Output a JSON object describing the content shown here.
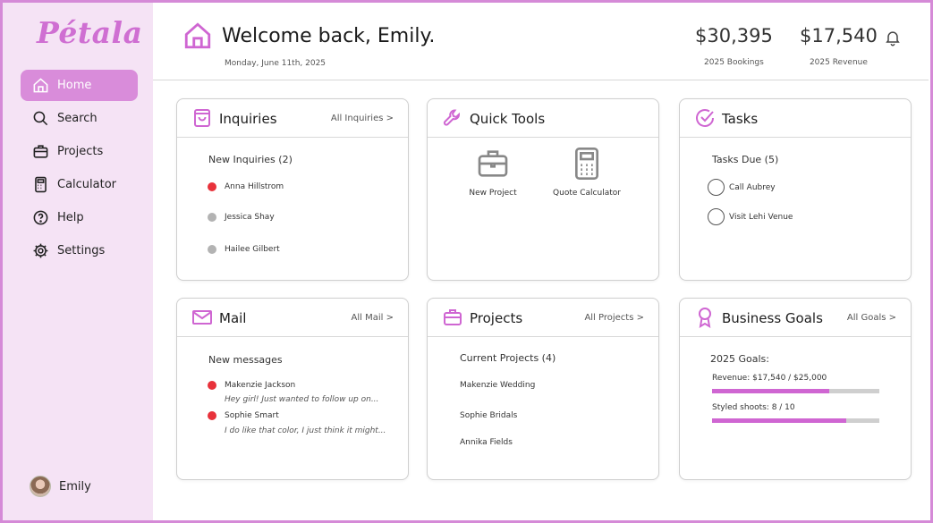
{
  "app": {
    "logo": "Pétala"
  },
  "colors": {
    "accent": "#cf66d2",
    "sidebar_bg": "#f5e3f5",
    "active_nav": "#d98cda",
    "new_dot": "#e8323b",
    "read_dot": "#b3b3b3"
  },
  "sidebar": {
    "items": [
      {
        "label": "Home",
        "icon": "home-icon",
        "active": true
      },
      {
        "label": "Search",
        "icon": "search-icon",
        "active": false
      },
      {
        "label": "Projects",
        "icon": "briefcase-icon",
        "active": false
      },
      {
        "label": "Calculator",
        "icon": "calculator-icon",
        "active": false
      },
      {
        "label": "Help",
        "icon": "help-icon",
        "active": false
      },
      {
        "label": "Settings",
        "icon": "gear-icon",
        "active": false
      }
    ],
    "user": {
      "name": "Emily"
    }
  },
  "header": {
    "welcome": "Welcome back, Emily.",
    "date": "Monday, June 11th, 2025",
    "bookings": {
      "value": "$30,395",
      "label": "2025 Bookings"
    },
    "revenue": {
      "value": "$17,540",
      "label": "2025 Revenue"
    }
  },
  "inquiries": {
    "title": "Inquiries",
    "link": "All Inquiries >",
    "subtitle": "New Inquiries (2)",
    "items": [
      {
        "name": "Anna Hillstrom",
        "status": "new"
      },
      {
        "name": "Jessica Shay",
        "status": "read"
      },
      {
        "name": "Hailee Gilbert",
        "status": "read"
      }
    ]
  },
  "quick_tools": {
    "title": "Quick Tools",
    "tools": [
      {
        "label": "New Project",
        "icon": "briefcase-icon"
      },
      {
        "label": "Quote Calculator",
        "icon": "calculator-icon"
      }
    ]
  },
  "tasks": {
    "title": "Tasks",
    "subtitle": "Tasks Due (5)",
    "items": [
      "Call Aubrey",
      "Visit Lehi Venue"
    ]
  },
  "mail": {
    "title": "Mail",
    "link": "All Mail >",
    "subtitle": "New messages",
    "items": [
      {
        "from": "Makenzie Jackson",
        "preview": "Hey girl! Just wanted to follow up on..."
      },
      {
        "from": "Sophie Smart",
        "preview": "I do like that color, I just think it might..."
      }
    ]
  },
  "projects": {
    "title": "Projects",
    "link": "All Projects >",
    "subtitle": "Current Projects (4)",
    "items": [
      "Makenzie Wedding",
      "Sophie Bridals",
      "Annika Fields"
    ]
  },
  "goals": {
    "title": "Business Goals",
    "link": "All Goals >",
    "subtitle": "2025 Goals:",
    "items": [
      {
        "label": "Revenue: $17,540 / $25,000",
        "progress": 0.7
      },
      {
        "label": "Styled shoots: 8 / 10",
        "progress": 0.8
      }
    ]
  }
}
